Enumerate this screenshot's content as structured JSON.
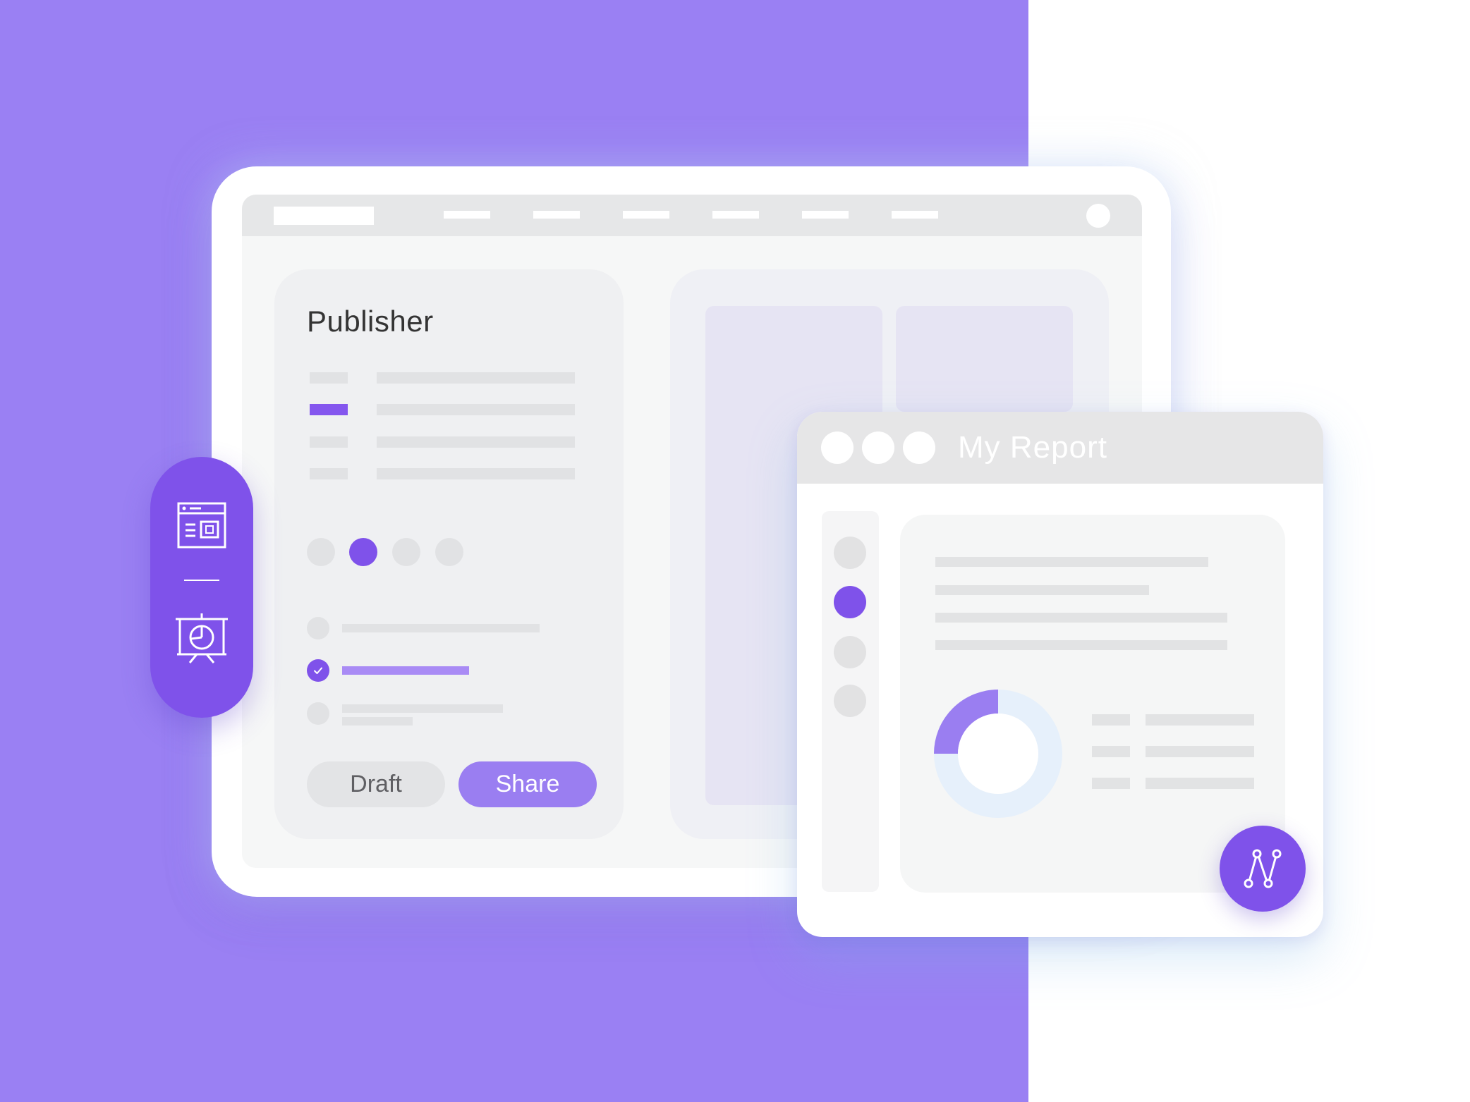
{
  "publisher": {
    "title": "Publisher",
    "buttons": {
      "draft_label": "Draft",
      "share_label": "Share"
    }
  },
  "report": {
    "title": "My Report"
  },
  "side_toolbar": {
    "icons": [
      "layout-template-icon",
      "presentation-chart-icon"
    ]
  },
  "fab": {
    "icon": "flow-path-icon"
  },
  "colors": {
    "accent": "#7f52ea",
    "accent_light": "#9a7ef1",
    "background": "#9a80f3"
  }
}
